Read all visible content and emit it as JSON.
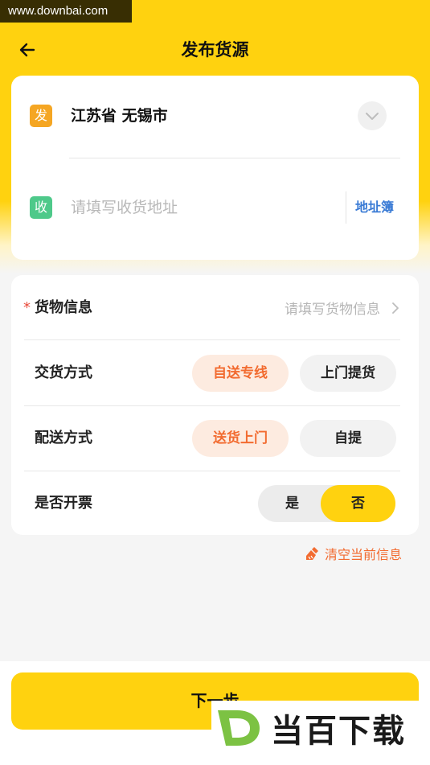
{
  "watermark_top": "www.downbai.com",
  "header": {
    "title": "发布货源",
    "back_icon": "arrow-left-icon"
  },
  "address": {
    "send_tag": "发",
    "from_text": "江苏省 无锡市",
    "recv_tag": "收",
    "to_placeholder": "请填写收货地址",
    "to_value": "",
    "address_book": "地址簿"
  },
  "cargo": {
    "required_mark": "*",
    "label": "货物信息",
    "placeholder": "请填写货物信息"
  },
  "delivery_handover": {
    "label": "交货方式",
    "options": [
      "自送专线",
      "上门提货"
    ],
    "selected": "自送专线"
  },
  "delivery_method": {
    "label": "配送方式",
    "options": [
      "送货上门",
      "自提"
    ],
    "selected": "送货上门"
  },
  "invoice": {
    "label": "是否开票",
    "options": [
      "是",
      "否"
    ],
    "selected": "否"
  },
  "clear_link": "清空当前信息",
  "next_button": "下一步",
  "brand_watermark": "当百下载",
  "colors": {
    "brand_yellow": "#ffd20f",
    "accent_orange": "#f26b30",
    "link_blue": "#3a7bd5",
    "send_tag": "#f5a623",
    "recv_tag": "#4ec98a"
  }
}
